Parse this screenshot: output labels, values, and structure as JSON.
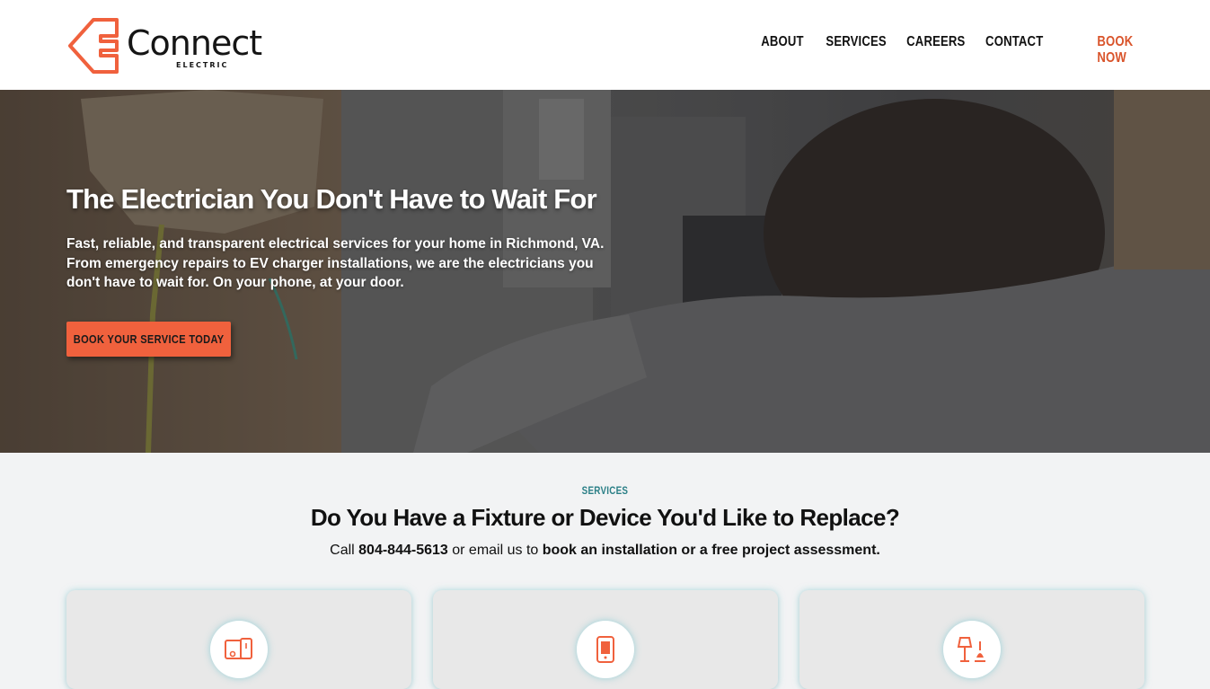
{
  "brand": {
    "name": "Connect",
    "sub": "ELECTRIC",
    "accent_color": "#f0613d",
    "book_color": "#d9542b",
    "teal_color": "#2a7f86"
  },
  "nav": {
    "items": [
      {
        "label": "ABOUT"
      },
      {
        "label": "SERVICES"
      },
      {
        "label": "CAREERS"
      },
      {
        "label": "CONTACT"
      },
      {
        "label": "BOOK NOW"
      }
    ]
  },
  "hero": {
    "title": "The Electrician You Don't Have to Wait For",
    "text": "Fast, reliable, and transparent electrical services for your home in Richmond, VA. From emergency repairs to EV charger installations, we are the electricians you don't have to wait for. On your phone, at your door.",
    "button_label": "BOOK YOUR SERVICE TODAY"
  },
  "services": {
    "eyebrow": "SERVICES",
    "title": "Do You Have a Fixture or Device You'd Like to Replace?",
    "sub_call": "Call ",
    "phone": "804-844-5613",
    "sub_mid": " or email us to ",
    "sub_cta": "book an installation or a free project assessment.",
    "cards": [
      {
        "icon": "devices-icon"
      },
      {
        "icon": "tablet-icon"
      },
      {
        "icon": "lamp-icon"
      }
    ]
  }
}
